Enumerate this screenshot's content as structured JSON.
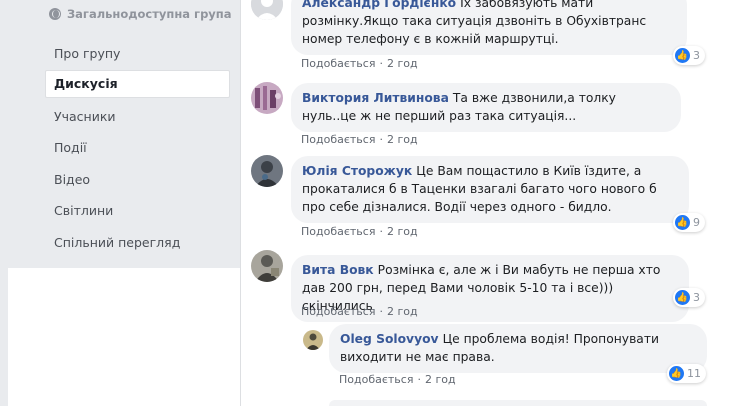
{
  "sidebar": {
    "group_type": "Загальнодоступна група",
    "items": [
      {
        "label": "Про групу"
      },
      {
        "label": "Дискусія"
      },
      {
        "label": "Учасники"
      },
      {
        "label": "Події"
      },
      {
        "label": "Відео"
      },
      {
        "label": "Світлини"
      },
      {
        "label": "Спільний перегляд"
      }
    ]
  },
  "comments": [
    {
      "author": "Александр Гордієнко",
      "text": "Їх забовязують мати розмінку.Якщо така ситуація дзвоніть в Обухівтранс номер телефону є в кожній маршрутці.",
      "like_label": "Подобається",
      "time": "2 год",
      "reactions": "3"
    },
    {
      "author": "Виктория Литвинова",
      "text": "Та вже дзвонили,а толку нуль..це ж не перший раз така ситуація...",
      "like_label": "Подобається",
      "time": "2 год",
      "reactions": ""
    },
    {
      "author": "Юлія Сторожук",
      "text": "Це Вам пощастило в Київ їздите, а прокаталися б в Таценки взагалі багато чого нового б про себе дізналися. Водії через одного - бидло.",
      "like_label": "Подобається",
      "time": "2 год",
      "reactions": "9"
    },
    {
      "author": "Вита Вовк",
      "text": "Розмінка є, але ж і Ви мабуть не перша хто дав 200 грн, перед Вами чоловік 5-10 та і все))) скінчились",
      "like_label": "Подобається",
      "time": "2 год",
      "reactions": "3"
    },
    {
      "author": "Oleg Solovyov",
      "text": "Це проблема водія! Пропонувати виходити не має права.",
      "like_label": "Подобається",
      "time": "2 год",
      "reactions": "11"
    }
  ],
  "colors": {
    "author": "#385898",
    "like_blue": "#2078f4",
    "bubble": "#f2f3f5",
    "page_bg": "#e9ebee"
  },
  "icons": {
    "group_type": "globe-icon",
    "reaction": "like-thumb-icon"
  }
}
